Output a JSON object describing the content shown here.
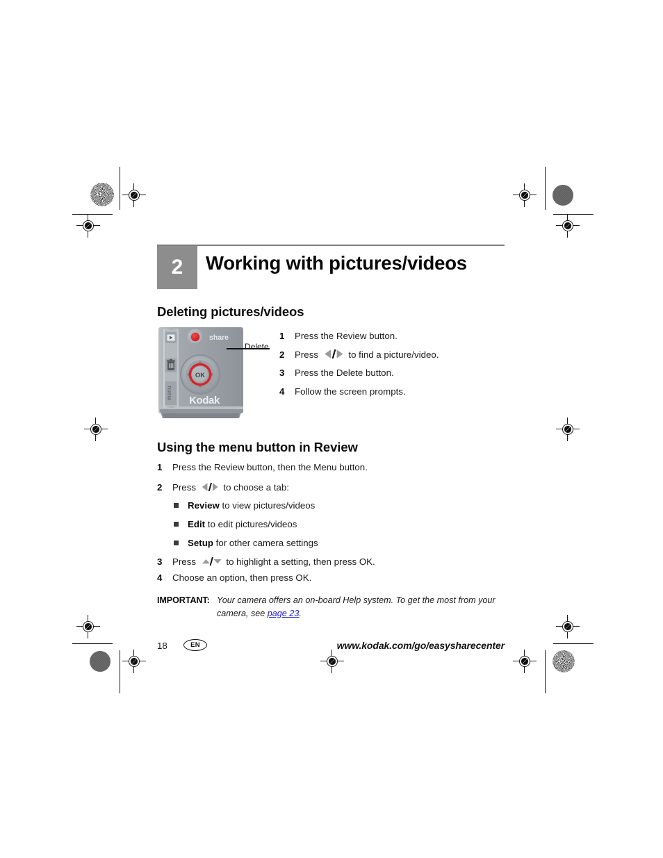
{
  "document": {
    "chapter_number": "2",
    "chapter_title": "Working with pictures/videos"
  },
  "sections": [
    {
      "heading": "Deleting pictures/videos",
      "figure": {
        "alt_name": "kodak-camera-back-controls",
        "callout_label": "Delete",
        "share_button_label": "share",
        "ok_button_label": "OK",
        "menu_button_label": "menu",
        "brand_label": "Kodak"
      },
      "steps": [
        {
          "num": "1",
          "pre": "Press the Review button.",
          "glyph": "",
          "post": ""
        },
        {
          "num": "2",
          "pre": "Press ",
          "glyph": "left-right",
          "post": " to find a picture/video."
        },
        {
          "num": "3",
          "pre": "Press the Delete button.",
          "glyph": "",
          "post": ""
        },
        {
          "num": "4",
          "pre": "Follow the screen prompts.",
          "glyph": "",
          "post": ""
        }
      ]
    },
    {
      "heading": "Using the menu button in Review",
      "steps": [
        {
          "num": "1",
          "pre": "Press the Review button, then the Menu button.",
          "glyph": "",
          "post": ""
        },
        {
          "num": "2",
          "pre": "Press ",
          "glyph": "left-right",
          "post": " to choose a tab:"
        }
      ],
      "bullets": [
        {
          "bold": "Review",
          "rest": " to view pictures/videos"
        },
        {
          "bold": "Edit",
          "rest": " to edit pictures/videos"
        },
        {
          "bold": "Setup",
          "rest": " for other camera settings"
        }
      ],
      "steps_after": [
        {
          "num": "3",
          "pre": "Press ",
          "glyph": "up-down",
          "post": " to highlight a setting, then press OK."
        },
        {
          "num": "4",
          "pre": "Choose an option, then press OK.",
          "glyph": "",
          "post": ""
        }
      ]
    }
  ],
  "important_note": {
    "label": "IMPORTANT:",
    "text_before_link": "Your camera offers an on-board Help system. To get the most from your camera, see ",
    "link_text": "page 23",
    "text_after_link": "."
  },
  "footer": {
    "page_number": "18",
    "language_badge": "EN",
    "url": "www.kodak.com/go/easysharecenter"
  },
  "colors": {
    "chapter_box": "#8d8d8d",
    "rule": "#7d7d7d",
    "link": "#2222cc",
    "text": "#1a1a1a",
    "camera_body": "#9aa0a6",
    "accent_red": "#d8232a"
  }
}
